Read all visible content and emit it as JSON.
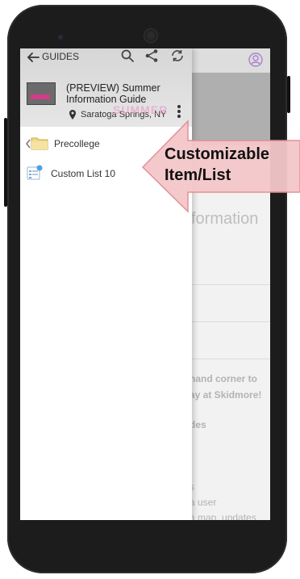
{
  "drawer": {
    "header": {
      "back_label": "GUIDES",
      "guide_title": "(PREVIEW) Summer Information Guide",
      "location": "Saratoga Springs, NY",
      "banner_text": "SUMMER"
    },
    "items": [
      {
        "label": "Precollege",
        "icon": "folder-icon"
      },
      {
        "label": "Custom List 10",
        "icon": "list-icon"
      }
    ]
  },
  "background": {
    "heading": "formation",
    "text_lines": [
      "hand corner to",
      "ay at Skidmore!",
      "des",
      "s",
      "a user",
      "a map, updates"
    ]
  },
  "callout": {
    "lines": [
      "Customizable",
      "Item/List"
    ],
    "color": "#f4c7c9",
    "border": "#e08d92"
  },
  "colors": {
    "phone_body": "#1c1c1c",
    "accent": "#9b59b6"
  }
}
